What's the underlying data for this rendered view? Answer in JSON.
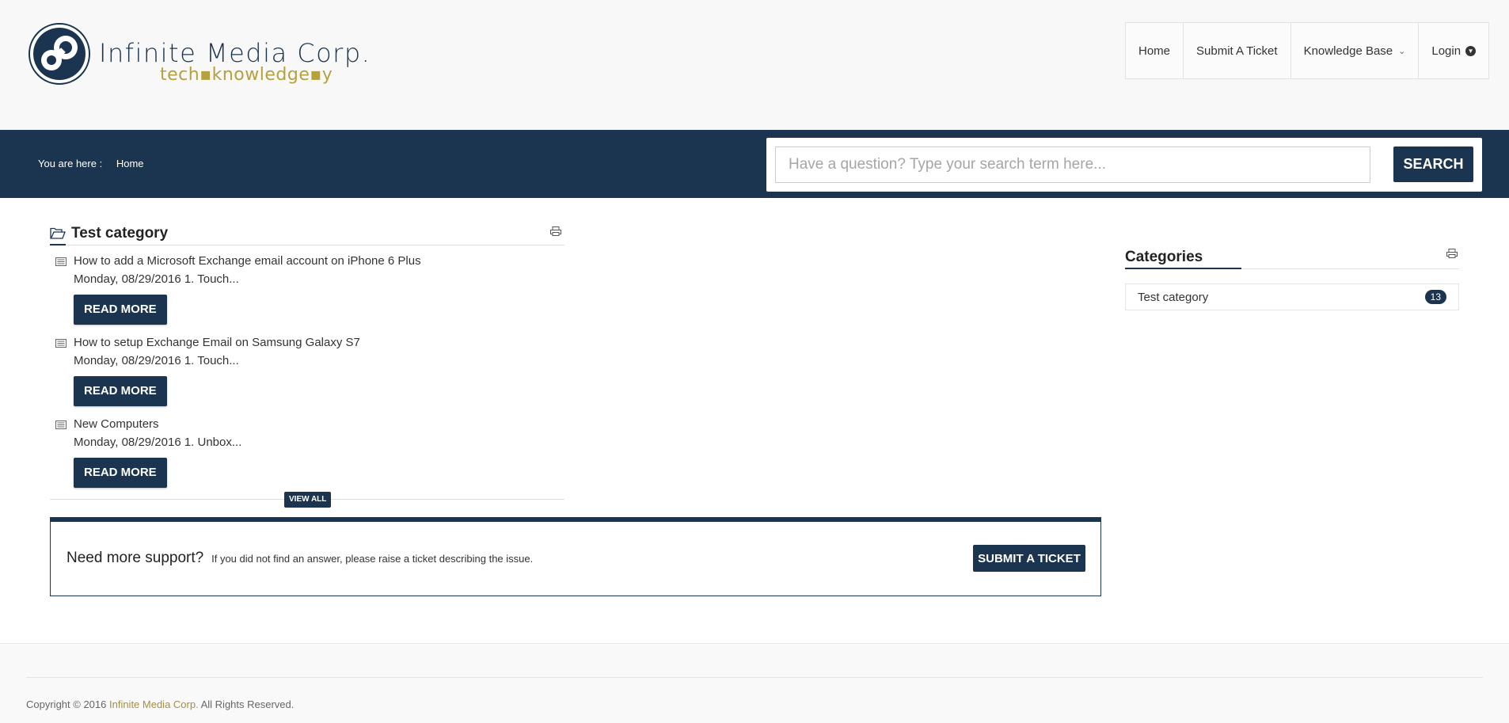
{
  "brand": {
    "title": "Infinite Media Corp.",
    "tagline": "tech▪knowledge▪y",
    "tagline_color": "#b5a13d"
  },
  "nav": {
    "items": [
      {
        "label": "Home"
      },
      {
        "label": "Submit A Ticket"
      },
      {
        "label": "Knowledge Base"
      },
      {
        "label": "Login"
      }
    ]
  },
  "breadcrumb": {
    "label": "You are here :",
    "current": "Home"
  },
  "search": {
    "placeholder": "Have a question? Type your search term here...",
    "button_label": "SEARCH"
  },
  "category": {
    "title": "Test category",
    "articles": [
      {
        "title": "How to add a Microsoft Exchange email account on iPhone 6 Plus",
        "excerpt": "Monday, 08/29/2016 1. Touch...",
        "button": "READ MORE"
      },
      {
        "title": "How to setup Exchange Email on Samsung Galaxy S7",
        "excerpt": "Monday, 08/29/2016 1. Touch...",
        "button": "READ MORE"
      },
      {
        "title": "New Computers",
        "excerpt": "Monday, 08/29/2016 1. Unbox...",
        "button": "READ MORE"
      }
    ],
    "view_all": "VIEW ALL"
  },
  "support": {
    "heading": "Need more support?",
    "description": "If you did not find an answer, please raise a ticket describing the issue.",
    "button": "SUBMIT A TICKET"
  },
  "sidebar": {
    "title": "Categories",
    "items": [
      {
        "label": "Test category",
        "count": "13"
      }
    ]
  },
  "footer": {
    "prefix": "Copyright © 2016 ",
    "brand": "Infinite Media Corp.",
    "suffix": " All Rights Reserved."
  },
  "colors": {
    "primary": "#1b3550",
    "accent": "#b5a13d"
  }
}
